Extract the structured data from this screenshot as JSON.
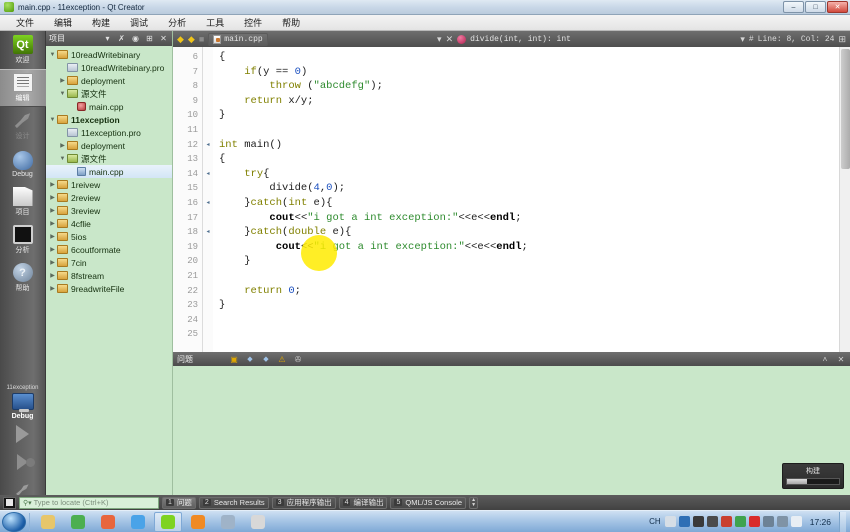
{
  "window": {
    "title": "main.cpp - 11exception - Qt Creator",
    "app_icon": "qt-creator-icon",
    "minimize": "–",
    "maximize": "□",
    "close": "✕"
  },
  "menu": {
    "items": [
      {
        "label": "文件"
      },
      {
        "label": "编辑"
      },
      {
        "label": "构建"
      },
      {
        "label": "调试"
      },
      {
        "label": "分析"
      },
      {
        "label": "工具"
      },
      {
        "label": "控件"
      },
      {
        "label": "帮助"
      }
    ]
  },
  "modebar": {
    "items": [
      {
        "label": "欢迎",
        "icon": "qt-welcome-icon",
        "state": "normal",
        "glyph": "Qt"
      },
      {
        "label": "编辑",
        "icon": "edit-document-icon",
        "state": "active",
        "glyph": ""
      },
      {
        "label": "设计",
        "icon": "design-tools-icon",
        "state": "disabled",
        "glyph": ""
      },
      {
        "label": "Debug",
        "icon": "debug-icon",
        "state": "normal",
        "glyph": ""
      },
      {
        "label": "项目",
        "icon": "projects-folder-icon",
        "state": "normal",
        "glyph": ""
      },
      {
        "label": "分析",
        "icon": "analyze-icon",
        "state": "normal",
        "glyph": ""
      },
      {
        "label": "帮助",
        "icon": "help-question-icon",
        "state": "normal",
        "glyph": "?"
      }
    ],
    "kit": {
      "project_name": "11exception",
      "build_config": "Debug",
      "target_icon": "desktop-target-icon",
      "run_button": "run-button",
      "debug_button": "debug-button",
      "build_button": "build-button"
    }
  },
  "sidebar": {
    "header": {
      "title": "项目",
      "dropdown_icon": "chevron-down-icon",
      "filter_icon": "filter-icon",
      "link_icon": "sync-with-editor-icon",
      "split_icon": "add-split-icon",
      "close_icon": "close-icon"
    },
    "tree": [
      {
        "label": "10readWritebinary",
        "indent": 0,
        "arrow": "open",
        "icon": "folder",
        "selected": false,
        "bold": false
      },
      {
        "label": "10readWritebinary.pro",
        "indent": 1,
        "arrow": "none",
        "icon": "pro",
        "selected": false,
        "bold": false
      },
      {
        "label": "deployment",
        "indent": 1,
        "arrow": "closed",
        "icon": "folder",
        "selected": false,
        "bold": false
      },
      {
        "label": "源文件",
        "indent": 1,
        "arrow": "open",
        "icon": "src",
        "selected": false,
        "bold": false
      },
      {
        "label": "main.cpp",
        "indent": 2,
        "arrow": "none",
        "icon": "cpp",
        "selected": false,
        "bold": false
      },
      {
        "label": "11exception",
        "indent": 0,
        "arrow": "open",
        "icon": "folder",
        "selected": false,
        "bold": true
      },
      {
        "label": "11exception.pro",
        "indent": 1,
        "arrow": "none",
        "icon": "pro",
        "selected": false,
        "bold": false
      },
      {
        "label": "deployment",
        "indent": 1,
        "arrow": "closed",
        "icon": "folder",
        "selected": false,
        "bold": false
      },
      {
        "label": "源文件",
        "indent": 1,
        "arrow": "open",
        "icon": "src",
        "selected": false,
        "bold": false
      },
      {
        "label": "main.cpp",
        "indent": 2,
        "arrow": "none",
        "icon": "cpp2",
        "selected": true,
        "bold": false
      },
      {
        "label": "1reivew",
        "indent": 0,
        "arrow": "closed",
        "icon": "folder",
        "selected": false,
        "bold": false
      },
      {
        "label": "2review",
        "indent": 0,
        "arrow": "closed",
        "icon": "folder",
        "selected": false,
        "bold": false
      },
      {
        "label": "3review",
        "indent": 0,
        "arrow": "closed",
        "icon": "folder",
        "selected": false,
        "bold": false
      },
      {
        "label": "4cflie",
        "indent": 0,
        "arrow": "closed",
        "icon": "folder",
        "selected": false,
        "bold": false
      },
      {
        "label": "5ios",
        "indent": 0,
        "arrow": "closed",
        "icon": "folder",
        "selected": false,
        "bold": false
      },
      {
        "label": "6coutformate",
        "indent": 0,
        "arrow": "closed",
        "icon": "folder",
        "selected": false,
        "bold": false
      },
      {
        "label": "7cin",
        "indent": 0,
        "arrow": "closed",
        "icon": "folder",
        "selected": false,
        "bold": false
      },
      {
        "label": "8fstream",
        "indent": 0,
        "arrow": "closed",
        "icon": "folder",
        "selected": false,
        "bold": false
      },
      {
        "label": "9readwriteFile",
        "indent": 0,
        "arrow": "closed",
        "icon": "folder",
        "selected": false,
        "bold": false
      }
    ]
  },
  "editor": {
    "toolbar": {
      "back_icon": "navigate-back-icon",
      "forward_icon": "navigate-forward-icon",
      "history_icon": "open-documents-icon",
      "file_name": "main.cpp",
      "file_dropdown_icon": "chevron-down-icon",
      "close_icon": "close-icon",
      "symbol_icon": "function-symbol-icon",
      "symbol_name": "divide(int, int): int",
      "symbol_dropdown_icon": "chevron-down-icon",
      "position_icon": "#",
      "position": "Line: 8, Col: 24",
      "split_icon": "split-editor-icon"
    },
    "first_line_number": 6,
    "lines": [
      {
        "n": 6,
        "fold": "",
        "tokens": [
          {
            "t": "{",
            "c": "pl"
          }
        ]
      },
      {
        "n": 7,
        "fold": "",
        "tokens": [
          {
            "t": "    ",
            "c": "pl"
          },
          {
            "t": "if",
            "c": "kw"
          },
          {
            "t": "(y == ",
            "c": "pl"
          },
          {
            "t": "0",
            "c": "num"
          },
          {
            "t": ")",
            "c": "pl"
          }
        ]
      },
      {
        "n": 8,
        "fold": "",
        "tokens": [
          {
            "t": "        ",
            "c": "pl"
          },
          {
            "t": "throw",
            "c": "kw"
          },
          {
            "t": " (",
            "c": "pl"
          },
          {
            "t": "\"abcdefg\"",
            "c": "str"
          },
          {
            "t": ");",
            "c": "pl"
          }
        ]
      },
      {
        "n": 9,
        "fold": "",
        "tokens": [
          {
            "t": "    ",
            "c": "pl"
          },
          {
            "t": "return",
            "c": "kw"
          },
          {
            "t": " x/y;",
            "c": "pl"
          }
        ]
      },
      {
        "n": 10,
        "fold": "",
        "tokens": [
          {
            "t": "}",
            "c": "pl"
          }
        ]
      },
      {
        "n": 11,
        "fold": "",
        "tokens": [
          {
            "t": "",
            "c": "pl"
          }
        ]
      },
      {
        "n": 12,
        "fold": "◂",
        "tokens": [
          {
            "t": "int",
            "c": "kw"
          },
          {
            "t": " main()",
            "c": "pl"
          }
        ]
      },
      {
        "n": 13,
        "fold": "",
        "tokens": [
          {
            "t": "{",
            "c": "pl"
          }
        ]
      },
      {
        "n": 14,
        "fold": "◂",
        "tokens": [
          {
            "t": "    ",
            "c": "pl"
          },
          {
            "t": "try",
            "c": "kw"
          },
          {
            "t": "{",
            "c": "pl"
          }
        ]
      },
      {
        "n": 15,
        "fold": "",
        "tokens": [
          {
            "t": "        divide(",
            "c": "pl"
          },
          {
            "t": "4",
            "c": "num"
          },
          {
            "t": ",",
            "c": "pl"
          },
          {
            "t": "0",
            "c": "num"
          },
          {
            "t": ");",
            "c": "pl"
          }
        ]
      },
      {
        "n": 16,
        "fold": "◂",
        "tokens": [
          {
            "t": "    }",
            "c": "pl"
          },
          {
            "t": "catch",
            "c": "kw"
          },
          {
            "t": "(",
            "c": "pl"
          },
          {
            "t": "int",
            "c": "kw"
          },
          {
            "t": " e){",
            "c": "pl"
          }
        ]
      },
      {
        "n": 17,
        "fold": "",
        "tokens": [
          {
            "t": "        ",
            "c": "pl"
          },
          {
            "t": "cout",
            "c": "kwb"
          },
          {
            "t": "<<",
            "c": "pl"
          },
          {
            "t": "\"i got a int exception:\"",
            "c": "str"
          },
          {
            "t": "<<e<<",
            "c": "pl"
          },
          {
            "t": "endl",
            "c": "kwb"
          },
          {
            "t": ";",
            "c": "pl"
          }
        ]
      },
      {
        "n": 18,
        "fold": "◂",
        "tokens": [
          {
            "t": "    }",
            "c": "pl"
          },
          {
            "t": "catch",
            "c": "kw"
          },
          {
            "t": "(",
            "c": "pl"
          },
          {
            "t": "double",
            "c": "kw"
          },
          {
            "t": " e){",
            "c": "pl"
          }
        ]
      },
      {
        "n": 19,
        "fold": "",
        "tokens": [
          {
            "t": "         ",
            "c": "pl"
          },
          {
            "t": "cout",
            "c": "kwb"
          },
          {
            "t": "<<",
            "c": "pl"
          },
          {
            "t": "\"i got a int exception:\"",
            "c": "str"
          },
          {
            "t": "<<e<<",
            "c": "pl"
          },
          {
            "t": "endl",
            "c": "kwb"
          },
          {
            "t": ";",
            "c": "pl"
          }
        ]
      },
      {
        "n": 20,
        "fold": "",
        "tokens": [
          {
            "t": "    }",
            "c": "pl"
          }
        ]
      },
      {
        "n": 21,
        "fold": "",
        "tokens": [
          {
            "t": "",
            "c": "pl"
          }
        ]
      },
      {
        "n": 22,
        "fold": "",
        "tokens": [
          {
            "t": "    ",
            "c": "pl"
          },
          {
            "t": "return",
            "c": "kw"
          },
          {
            "t": " ",
            "c": "pl"
          },
          {
            "t": "0",
            "c": "num"
          },
          {
            "t": ";",
            "c": "pl"
          }
        ]
      },
      {
        "n": 23,
        "fold": "",
        "tokens": [
          {
            "t": "}",
            "c": "pl"
          }
        ]
      },
      {
        "n": 24,
        "fold": "",
        "tokens": [
          {
            "t": "",
            "c": "pl"
          }
        ]
      },
      {
        "n": 25,
        "fold": "",
        "tokens": [
          {
            "t": "",
            "c": "pl"
          }
        ]
      }
    ]
  },
  "issues_pane": {
    "title": "问题",
    "icons": [
      {
        "name": "error-warning-filter-icon",
        "glyph": "▣"
      },
      {
        "name": "previous-item-icon",
        "glyph": "◆"
      },
      {
        "name": "next-item-icon",
        "glyph": "◆"
      },
      {
        "name": "warning-icon",
        "glyph": "⚠"
      },
      {
        "name": "filter-icon",
        "glyph": "✇"
      }
    ],
    "maximize_icon": "˄",
    "close_icon": "✕",
    "build_progress": {
      "label": "构建",
      "percent": 38
    }
  },
  "statusbar": {
    "sidebar_toggle_icon": "toggle-sidebar-icon",
    "locator": {
      "icon": "search-icon",
      "placeholder": "Type to locate (Ctrl+K)",
      "value": ""
    },
    "output_buttons": [
      {
        "num": "1",
        "label": "问题",
        "active": true
      },
      {
        "num": "2",
        "label": "Search Results",
        "active": false
      },
      {
        "num": "3",
        "label": "应用程序输出",
        "active": false
      },
      {
        "num": "4",
        "label": "编译输出",
        "active": false
      },
      {
        "num": "5",
        "label": "QML/JS Console",
        "active": false
      }
    ],
    "spinner_icon": "output-pane-spinner-icon"
  },
  "taskbar": {
    "start_icon": "windows-start-orb",
    "items": [
      {
        "name": "file-explorer-icon",
        "color": "#e7c66b",
        "active": false
      },
      {
        "name": "chrome-icon",
        "color": "#4caf50",
        "active": false
      },
      {
        "name": "firefox-icon",
        "color": "#e8663d",
        "active": false
      },
      {
        "name": "messenger-icon",
        "color": "#4aa3e8",
        "active": false
      },
      {
        "name": "qt-creator-icon",
        "color": "#7ed321",
        "active": true
      },
      {
        "name": "editor-app-icon",
        "color": "#f08a24",
        "active": false
      },
      {
        "name": "media-app-icon",
        "color": "#9fb3c8",
        "active": false
      },
      {
        "name": "document-app-icon",
        "color": "#d8d8d8",
        "active": false
      }
    ],
    "tray": {
      "ime": "CH",
      "icons": [
        {
          "name": "keyboard-icon",
          "color": "#d6dee6"
        },
        {
          "name": "help-tray-icon",
          "color": "#2f6fb5"
        },
        {
          "name": "network-icon",
          "color": "#3a3a3a"
        },
        {
          "name": "share-icon",
          "color": "#4b4b4b"
        },
        {
          "name": "antivirus-icon",
          "color": "#c9402f"
        },
        {
          "name": "check-status-icon",
          "color": "#3fa34d"
        },
        {
          "name": "record-icon",
          "color": "#d92b2b"
        },
        {
          "name": "screen-icon",
          "color": "#6d8296"
        },
        {
          "name": "sync-icon",
          "color": "#7f93a6"
        },
        {
          "name": "volume-icon",
          "color": "#e8eef4"
        }
      ],
      "clock": "17:26"
    }
  }
}
